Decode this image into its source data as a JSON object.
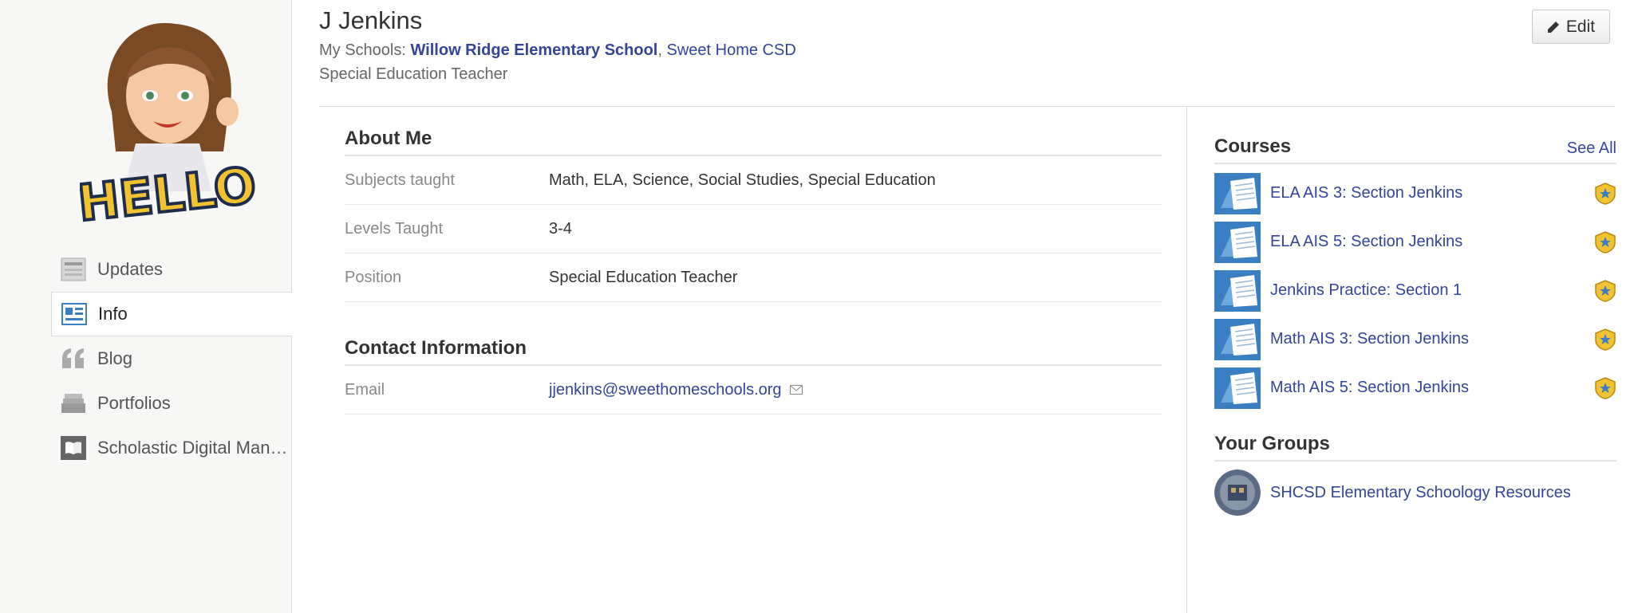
{
  "profile": {
    "name": "J Jenkins",
    "schools_prefix": "My Schools: ",
    "school_primary": "Willow Ridge Elementary School",
    "school_separator": ", ",
    "school_secondary": "Sweet Home CSD",
    "role": "Special Education Teacher",
    "edit_label": "Edit"
  },
  "sidebar": {
    "items": [
      {
        "label": "Updates",
        "icon": "updates-icon"
      },
      {
        "label": "Info",
        "icon": "info-icon"
      },
      {
        "label": "Blog",
        "icon": "quote-icon"
      },
      {
        "label": "Portfolios",
        "icon": "portfolio-icon"
      },
      {
        "label": "Scholastic Digital Manager",
        "icon": "book-icon"
      }
    ],
    "active": "Info"
  },
  "about": {
    "title": "About Me",
    "rows": [
      {
        "label": "Subjects taught",
        "value": "Math, ELA, Science, Social Studies, Special Education"
      },
      {
        "label": "Levels Taught",
        "value": "3-4"
      },
      {
        "label": "Position",
        "value": "Special Education Teacher"
      }
    ]
  },
  "contact": {
    "title": "Contact Information",
    "email_label": "Email",
    "email_value": "jjenkins@sweethomeschools.org"
  },
  "courses": {
    "title": "Courses",
    "see_all": "See All",
    "items": [
      "ELA AIS 3: Section Jenkins",
      "ELA AIS 5: Section Jenkins",
      "Jenkins Practice: Section 1",
      "Math AIS 3: Section Jenkins",
      "Math AIS 5: Section Jenkins"
    ]
  },
  "groups": {
    "title": "Your Groups",
    "items": [
      "SHCSD Elementary Schoology Resources"
    ]
  },
  "colors": {
    "link": "#334499",
    "course_thumb": "#3a7fc1",
    "badge": "#f2c230"
  }
}
